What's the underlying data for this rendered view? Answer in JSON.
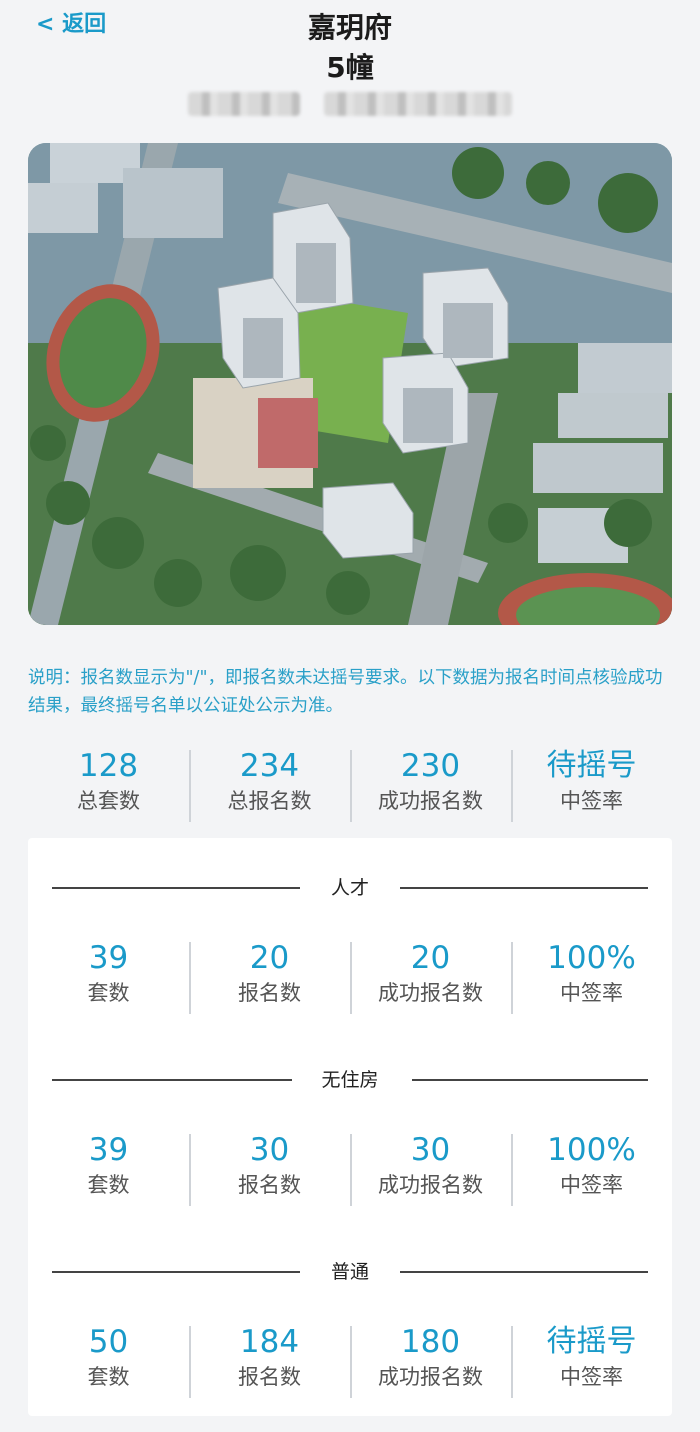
{
  "header": {
    "back_label": "< 返回",
    "title": "嘉玥府",
    "subtitle": "5幢"
  },
  "note": "说明：报名数显示为\"/\"，即报名数未达摇号要求。以下数据为报名时间点核验成功结果，最终摇号名单以公证处公示为准。",
  "summary": [
    {
      "value": "128",
      "label": "总套数"
    },
    {
      "value": "234",
      "label": "总报名数"
    },
    {
      "value": "230",
      "label": "成功报名数"
    },
    {
      "value": "待摇号",
      "label": "中签率"
    }
  ],
  "sections": [
    {
      "name": "人才",
      "stats": [
        {
          "value": "39",
          "label": "套数"
        },
        {
          "value": "20",
          "label": "报名数"
        },
        {
          "value": "20",
          "label": "成功报名数"
        },
        {
          "value": "100%",
          "label": "中签率"
        }
      ]
    },
    {
      "name": "无住房",
      "stats": [
        {
          "value": "39",
          "label": "套数"
        },
        {
          "value": "30",
          "label": "报名数"
        },
        {
          "value": "30",
          "label": "成功报名数"
        },
        {
          "value": "100%",
          "label": "中签率"
        }
      ]
    },
    {
      "name": "普通",
      "stats": [
        {
          "value": "50",
          "label": "套数"
        },
        {
          "value": "184",
          "label": "报名数"
        },
        {
          "value": "180",
          "label": "成功报名数"
        },
        {
          "value": "待摇号",
          "label": "中签率"
        }
      ]
    }
  ],
  "colors": {
    "accent": "#1a9ac9",
    "note": "#2aa0c8",
    "label": "#555555"
  }
}
